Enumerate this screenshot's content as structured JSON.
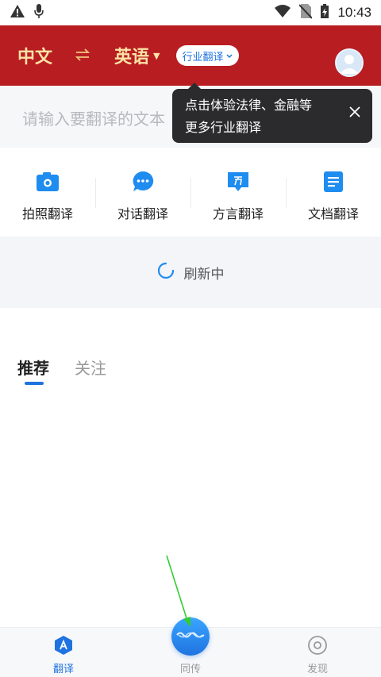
{
  "status_bar": {
    "time": "10:43",
    "icons": [
      "warning-icon",
      "mic-icon",
      "wifi-icon",
      "no-sim-icon",
      "battery-charging-icon"
    ]
  },
  "header": {
    "source_lang": "中文",
    "target_lang": "英语",
    "industry_label": "行业翻译",
    "colors": {
      "background": "#b81d22",
      "lang_text": "#fbe3a5"
    }
  },
  "input": {
    "placeholder": "请输入要翻译的文本"
  },
  "tooltip": {
    "line1": "点击体验法律、金融等",
    "line2": "更多行业翻译"
  },
  "tools": [
    {
      "label": "拍照翻译",
      "icon": "camera-icon"
    },
    {
      "label": "对话翻译",
      "icon": "chat-bubble-icon"
    },
    {
      "label": "方言翻译",
      "icon": "dialect-icon"
    },
    {
      "label": "文档翻译",
      "icon": "document-icon"
    }
  ],
  "refresh": {
    "text": "刷新中"
  },
  "feed_tabs": [
    {
      "label": "推荐",
      "active": true
    },
    {
      "label": "关注",
      "active": false
    }
  ],
  "bottom_nav": {
    "items": [
      {
        "label": "翻译",
        "icon": "translate-icon",
        "active": true
      },
      {
        "label": "同传",
        "icon": "sound-wave-icon",
        "active": false
      },
      {
        "label": "发现",
        "icon": "discover-icon",
        "active": false
      }
    ],
    "accent": "#1f73e0"
  }
}
